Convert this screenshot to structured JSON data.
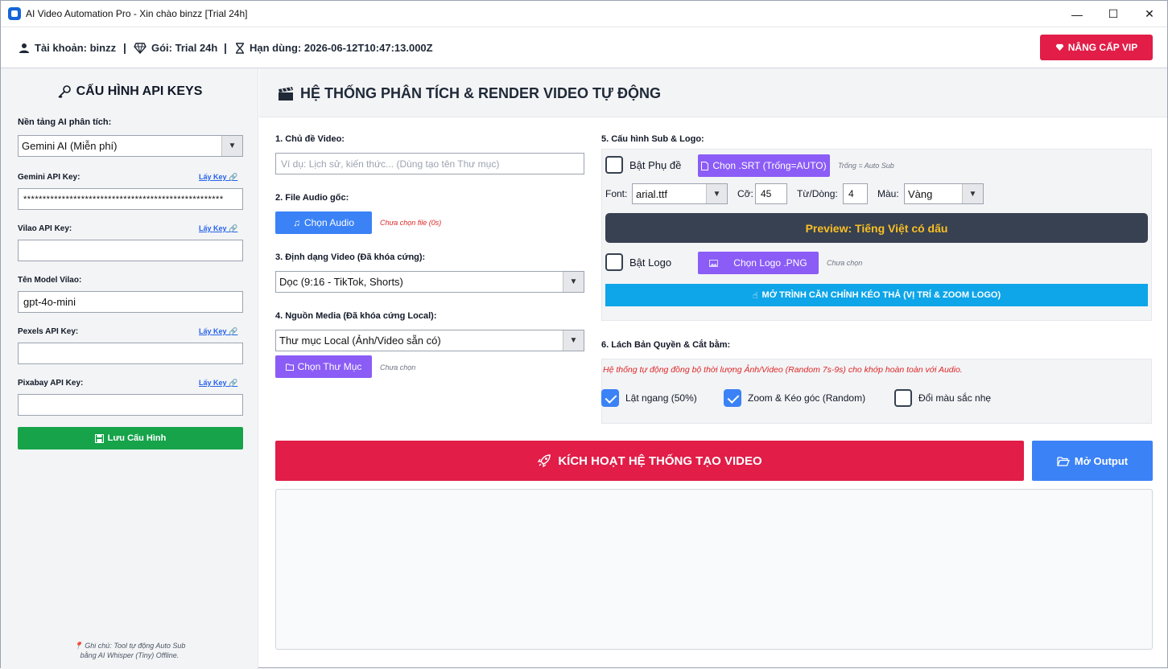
{
  "window": {
    "title": "AI Video Automation Pro - Xin chào binzz [Trial 24h]",
    "minimize": "—",
    "maximize": "☐",
    "close": "✕"
  },
  "header": {
    "account": "Tài khoản: binzz",
    "plan": "Gói: Trial 24h",
    "expiry": "Hạn dùng: 2026-06-12T10:47:13.000Z",
    "separator": "|",
    "vip_button": "NÂNG CẤP VIP"
  },
  "sidebar": {
    "title": "CẤU HÌNH API KEYS",
    "platform_label": "Nền tảng AI phân tích:",
    "platform_value": "Gemini AI (Miễn phí)",
    "gemini_label": "Gemini API Key:",
    "gemini_value": "****************************************************",
    "vilao_label": "Vilao API Key:",
    "vilao_value": "",
    "model_label": "Tên Model Vilao:",
    "model_value": "gpt-4o-mini",
    "pexels_label": "Pexels API Key:",
    "pexels_value": "",
    "pixabay_label": "Pixabay API Key:",
    "pixabay_value": "",
    "get_key": "Lấy Key",
    "save_button": "Lưu Cấu Hình",
    "note_line1": "Ghi chú: Tool tự động Auto Sub",
    "note_line2": "bằng AI Whisper (Tiny) Offline."
  },
  "main": {
    "title": "HỆ THỐNG PHÂN TÍCH & RENDER VIDEO TỰ ĐỘNG",
    "topic_label": "1. Chủ đề Video:",
    "topic_placeholder": "Ví dụ: Lịch sử, kiến thức... (Dùng tạo tên Thư mục)",
    "audio_label": "2. File Audio gốc:",
    "audio_button": "Chọn Audio",
    "audio_hint": "Chưa chọn file (0s)",
    "format_label": "3. Định dạng Video (Đã khóa cứng):",
    "format_value": "Dọc (9:16 - TikTok, Shorts)",
    "source_label": "4. Nguồn Media (Đã khóa cứng Local):",
    "source_value": "Thư mục Local (Ảnh/Video sẵn có)",
    "folder_button": "Chọn Thư Mục",
    "folder_hint": "Chưa chọn",
    "sub_label": "5. Cấu hình Sub & Logo:",
    "sub_enable": "Bật Phụ đề",
    "srt_button": "Chọn .SRT (Trống=AUTO)",
    "srt_hint": "Trống = Auto Sub",
    "font_label": "Font:",
    "font_value": "arial.ttf",
    "size_label": "Cỡ:",
    "size_value": "45",
    "words_label": "Từ/Dòng:",
    "words_value": "4",
    "color_label": "Màu:",
    "color_value": "Vàng",
    "preview_text": "Preview: Tiếng Việt có dấu",
    "logo_enable": "Bật Logo",
    "logo_button": "Chọn Logo .PNG",
    "logo_hint": "Chưa chọn",
    "align_button": "MỞ TRÌNH CĂN CHỈNH KÉO THẢ (VỊ TRÍ & ZOOM LOGO)",
    "copyright_label": "6. Lách Bản Quyền & Cắt bằm:",
    "copyright_hint": "Hệ thống tự động đồng bộ thời lượng Ảnh/Video (Random 7s-9s) cho khớp hoàn toàn với Audio.",
    "flip_label": "Lật ngang (50%)",
    "zoom_label": "Zoom & Kéo góc (Random)",
    "color_shift_label": "Đổi màu sắc nhẹ",
    "run_button": "KÍCH HOẠT HỆ THỐNG TẠO VIDEO",
    "output_button": "Mở Output",
    "log_text": ""
  },
  "colors": {
    "vip": "#e11d48",
    "save": "#16a34a",
    "primary": "#3b82f6",
    "purple": "#8b5cf6",
    "cyan": "#0ea5e9",
    "preview_bg": "#374151",
    "preview_text": "#fbbf24"
  }
}
